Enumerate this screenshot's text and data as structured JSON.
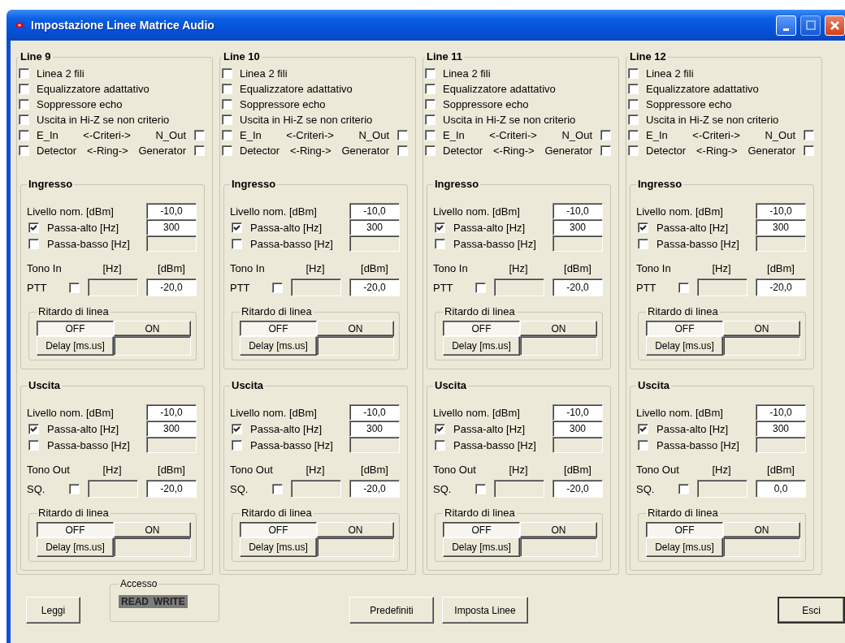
{
  "window": {
    "title": "Impostazione Linee Matrice Audio",
    "maximize_disabled": true
  },
  "lines": [
    {
      "title": "Line 9",
      "options": [
        {
          "label": "Linea 2 fili",
          "checked": false
        },
        {
          "label": "Equalizzatore adattativo",
          "checked": false
        },
        {
          "label": "Soppressore echo",
          "checked": false
        },
        {
          "label": "Uscita in Hi-Z se non criterio",
          "checked": false
        }
      ],
      "pairs": [
        {
          "left": {
            "label": "E_In",
            "checked": false
          },
          "middle": "<-Criteri->",
          "right": {
            "label": "N_Out",
            "checked": false
          }
        },
        {
          "left": {
            "label": "Detector",
            "checked": false
          },
          "middle": "<-Ring->",
          "right": {
            "label": "Generator",
            "checked": false
          }
        }
      ],
      "sections": [
        {
          "title": "Ingresso",
          "level": {
            "label": "Livello nom. [dBm]",
            "value": "-10,0"
          },
          "high_pass": {
            "label": "Passa-alto [Hz]",
            "checked": true,
            "value": "300"
          },
          "low_pass": {
            "label": "Passa-basso [Hz]",
            "checked": false
          },
          "tone": {
            "label": "Tono In",
            "hz_label": "[Hz]",
            "dbm_label": "[dBm]",
            "switch_label": "PTT",
            "checked": false,
            "value": "-20,0"
          },
          "delay": {
            "title": "Ritardo di linea",
            "off": {
              "label": "OFF",
              "selected": true
            },
            "on": {
              "label": "ON",
              "selected": false
            },
            "button": "Delay [ms.us]"
          }
        },
        {
          "title": "Uscita",
          "level": {
            "label": "Livello nom. [dBm]",
            "value": "-10,0"
          },
          "high_pass": {
            "label": "Passa-alto [Hz]",
            "checked": true,
            "value": "300"
          },
          "low_pass": {
            "label": "Passa-basso [Hz]",
            "checked": false
          },
          "tone": {
            "label": "Tono Out",
            "hz_label": "[Hz]",
            "dbm_label": "[dBm]",
            "switch_label": "SQ.",
            "checked": false,
            "value": "-20,0"
          },
          "delay": {
            "title": "Ritardo di linea",
            "off": {
              "label": "OFF",
              "selected": true
            },
            "on": {
              "label": "ON",
              "selected": false
            },
            "button": "Delay [ms.us]"
          }
        }
      ]
    },
    {
      "title": "Line 10",
      "options": [
        {
          "label": "Linea 2 fili",
          "checked": false
        },
        {
          "label": "Equalizzatore adattativo",
          "checked": false
        },
        {
          "label": "Soppressore echo",
          "checked": false
        },
        {
          "label": "Uscita in Hi-Z se non criterio",
          "checked": false
        }
      ],
      "pairs": [
        {
          "left": {
            "label": "E_In",
            "checked": false
          },
          "middle": "<-Criteri->",
          "right": {
            "label": "N_Out",
            "checked": false
          }
        },
        {
          "left": {
            "label": "Detector",
            "checked": false
          },
          "middle": "<-Ring->",
          "right": {
            "label": "Generator",
            "checked": false
          }
        }
      ],
      "sections": [
        {
          "title": "Ingresso",
          "level": {
            "label": "Livello nom. [dBm]",
            "value": "-10,0"
          },
          "high_pass": {
            "label": "Passa-alto [Hz]",
            "checked": true,
            "value": "300"
          },
          "low_pass": {
            "label": "Passa-basso [Hz]",
            "checked": false
          },
          "tone": {
            "label": "Tono In",
            "hz_label": "[Hz]",
            "dbm_label": "[dBm]",
            "switch_label": "PTT",
            "checked": false,
            "value": "-20,0"
          },
          "delay": {
            "title": "Ritardo di linea",
            "off": {
              "label": "OFF",
              "selected": true
            },
            "on": {
              "label": "ON",
              "selected": false
            },
            "button": "Delay [ms.us]"
          }
        },
        {
          "title": "Uscita",
          "level": {
            "label": "Livello nom. [dBm]",
            "value": "-10,0"
          },
          "high_pass": {
            "label": "Passa-alto [Hz]",
            "checked": true,
            "value": "300"
          },
          "low_pass": {
            "label": "Passa-basso [Hz]",
            "checked": false
          },
          "tone": {
            "label": "Tono Out",
            "hz_label": "[Hz]",
            "dbm_label": "[dBm]",
            "switch_label": "SQ.",
            "checked": false,
            "value": "-20,0"
          },
          "delay": {
            "title": "Ritardo di linea",
            "off": {
              "label": "OFF",
              "selected": true
            },
            "on": {
              "label": "ON",
              "selected": false
            },
            "button": "Delay [ms.us]"
          }
        }
      ]
    },
    {
      "title": "Line 11",
      "options": [
        {
          "label": "Linea 2 fili",
          "checked": false
        },
        {
          "label": "Equalizzatore adattativo",
          "checked": false
        },
        {
          "label": "Soppressore echo",
          "checked": false
        },
        {
          "label": "Uscita in Hi-Z se non criterio",
          "checked": false
        }
      ],
      "pairs": [
        {
          "left": {
            "label": "E_In",
            "checked": false
          },
          "middle": "<-Criteri->",
          "right": {
            "label": "N_Out",
            "checked": false
          }
        },
        {
          "left": {
            "label": "Detector",
            "checked": false
          },
          "middle": "<-Ring->",
          "right": {
            "label": "Generator",
            "checked": false
          }
        }
      ],
      "sections": [
        {
          "title": "Ingresso",
          "level": {
            "label": "Livello nom. [dBm]",
            "value": "-10,0"
          },
          "high_pass": {
            "label": "Passa-alto [Hz]",
            "checked": true,
            "value": "300"
          },
          "low_pass": {
            "label": "Passa-basso [Hz]",
            "checked": false
          },
          "tone": {
            "label": "Tono In",
            "hz_label": "[Hz]",
            "dbm_label": "[dBm]",
            "switch_label": "PTT",
            "checked": false,
            "value": "-20,0"
          },
          "delay": {
            "title": "Ritardo di linea",
            "off": {
              "label": "OFF",
              "selected": true
            },
            "on": {
              "label": "ON",
              "selected": false
            },
            "button": "Delay [ms.us]"
          }
        },
        {
          "title": "Uscita",
          "level": {
            "label": "Livello nom. [dBm]",
            "value": "-10,0"
          },
          "high_pass": {
            "label": "Passa-alto [Hz]",
            "checked": true,
            "value": "300"
          },
          "low_pass": {
            "label": "Passa-basso [Hz]",
            "checked": false
          },
          "tone": {
            "label": "Tono Out",
            "hz_label": "[Hz]",
            "dbm_label": "[dBm]",
            "switch_label": "SQ.",
            "checked": false,
            "value": "-20,0"
          },
          "delay": {
            "title": "Ritardo di linea",
            "off": {
              "label": "OFF",
              "selected": true
            },
            "on": {
              "label": "ON",
              "selected": false
            },
            "button": "Delay [ms.us]"
          }
        }
      ]
    },
    {
      "title": "Line 12",
      "options": [
        {
          "label": "Linea 2 fili",
          "checked": false
        },
        {
          "label": "Equalizzatore adattativo",
          "checked": false
        },
        {
          "label": "Soppressore echo",
          "checked": false
        },
        {
          "label": "Uscita in Hi-Z se non criterio",
          "checked": false
        }
      ],
      "pairs": [
        {
          "left": {
            "label": "E_In",
            "checked": false
          },
          "middle": "<-Criteri->",
          "right": {
            "label": "N_Out",
            "checked": false
          }
        },
        {
          "left": {
            "label": "Detector",
            "checked": false
          },
          "middle": "<-Ring->",
          "right": {
            "label": "Generator",
            "checked": false
          }
        }
      ],
      "sections": [
        {
          "title": "Ingresso",
          "level": {
            "label": "Livello nom. [dBm]",
            "value": "-10,0"
          },
          "high_pass": {
            "label": "Passa-alto [Hz]",
            "checked": true,
            "value": "300"
          },
          "low_pass": {
            "label": "Passa-basso [Hz]",
            "checked": false
          },
          "tone": {
            "label": "Tono In",
            "hz_label": "[Hz]",
            "dbm_label": "[dBm]",
            "switch_label": "PTT",
            "checked": false,
            "value": "-20,0"
          },
          "delay": {
            "title": "Ritardo di linea",
            "off": {
              "label": "OFF",
              "selected": true
            },
            "on": {
              "label": "ON",
              "selected": false
            },
            "button": "Delay [ms.us]"
          }
        },
        {
          "title": "Uscita",
          "level": {
            "label": "Livello nom. [dBm]",
            "value": "-10,0"
          },
          "high_pass": {
            "label": "Passa-alto [Hz]",
            "checked": true,
            "value": "300"
          },
          "low_pass": {
            "label": "Passa-basso [Hz]",
            "checked": false
          },
          "tone": {
            "label": "Tono Out",
            "hz_label": "[Hz]",
            "dbm_label": "[dBm]",
            "switch_label": "SQ.",
            "checked": false,
            "value": "0,0"
          },
          "delay": {
            "title": "Ritardo di linea",
            "off": {
              "label": "OFF",
              "selected": true
            },
            "on": {
              "label": "ON",
              "selected": false
            },
            "button": "Delay [ms.us]"
          }
        }
      ]
    }
  ],
  "footer": {
    "read_button": "Leggi",
    "access": {
      "title": "Accesso",
      "indicators": [
        "READ",
        "WRITE"
      ]
    },
    "defaults_button": "Predefiniti",
    "apply_button": "Imposta Linee",
    "exit_button": "Esci"
  }
}
